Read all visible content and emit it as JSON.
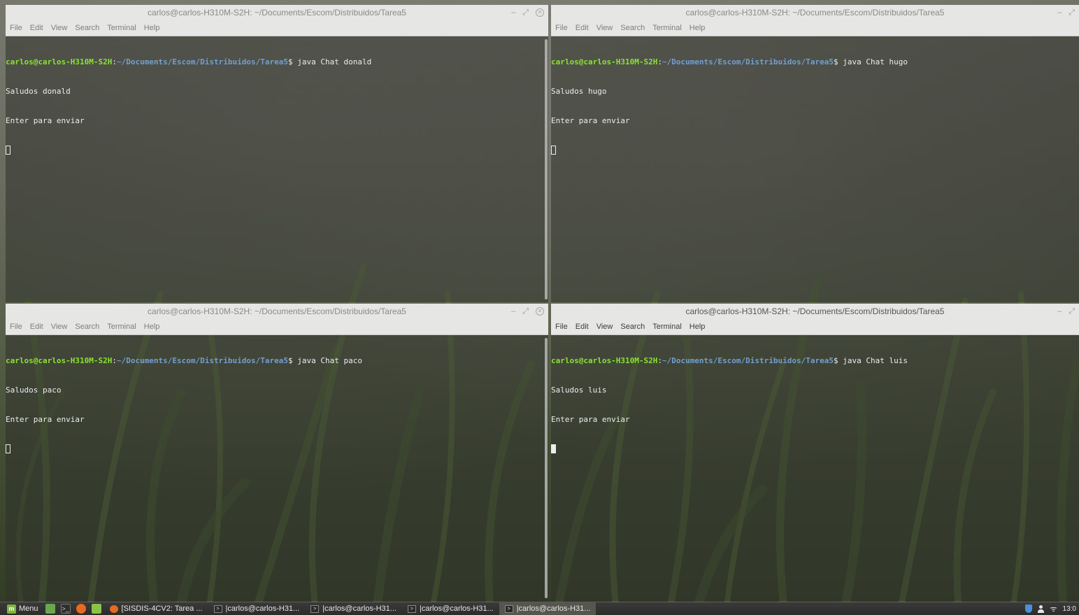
{
  "windows": [
    {
      "id": "tl",
      "title": "carlos@carlos-H310M-S2H: ~/Documents/Escom/Distribuidos/Tarea5",
      "menu": [
        "File",
        "Edit",
        "View",
        "Search",
        "Terminal",
        "Help"
      ],
      "prompt_user": "carlos@carlos-H310M-S2H",
      "prompt_colon": ":",
      "prompt_path": "~/Documents/Escom/Distribuidos/Tarea5",
      "command": "$ java Chat donald",
      "output": [
        "Saludos donald",
        "Enter para enviar"
      ],
      "focused": false,
      "has_close": true
    },
    {
      "id": "tr",
      "title": "carlos@carlos-H310M-S2H: ~/Documents/Escom/Distribuidos/Tarea5",
      "menu": [
        "File",
        "Edit",
        "View",
        "Search",
        "Terminal",
        "Help"
      ],
      "prompt_user": "carlos@carlos-H310M-S2H",
      "prompt_colon": ":",
      "prompt_path": "~/Documents/Escom/Distribuidos/Tarea5",
      "command": "$ java Chat hugo",
      "output": [
        "Saludos hugo",
        "Enter para enviar"
      ],
      "focused": false,
      "has_close": false
    },
    {
      "id": "bl",
      "title": "carlos@carlos-H310M-S2H: ~/Documents/Escom/Distribuidos/Tarea5",
      "menu": [
        "File",
        "Edit",
        "View",
        "Search",
        "Terminal",
        "Help"
      ],
      "prompt_user": "carlos@carlos-H310M-S2H",
      "prompt_colon": ":",
      "prompt_path": "~/Documents/Escom/Distribuidos/Tarea5",
      "command": "$ java Chat paco",
      "output": [
        "Saludos paco",
        "Enter para enviar"
      ],
      "focused": false,
      "has_close": true
    },
    {
      "id": "br",
      "title": "carlos@carlos-H310M-S2H: ~/Documents/Escom/Distribuidos/Tarea5",
      "menu": [
        "File",
        "Edit",
        "View",
        "Search",
        "Terminal",
        "Help"
      ],
      "prompt_user": "carlos@carlos-H310M-S2H",
      "prompt_colon": ":",
      "prompt_path": "~/Documents/Escom/Distribuidos/Tarea5",
      "command": "$ java Chat luis",
      "output": [
        "Saludos luis",
        "Enter para enviar"
      ],
      "focused": true,
      "has_close": false
    }
  ],
  "taskbar": {
    "menu_label": "Menu",
    "tasks": [
      {
        "label": "[SISDIS-4CV2: Tarea ...",
        "icon": "firefox-icon",
        "active": false
      },
      {
        "label": "|carlos@carlos-H31...",
        "icon": "terminal-icon",
        "active": false
      },
      {
        "label": "|carlos@carlos-H31...",
        "icon": "terminal-icon",
        "active": false
      },
      {
        "label": "|carlos@carlos-H31...",
        "icon": "terminal-icon",
        "active": false
      },
      {
        "label": "|carlos@carlos-H31...",
        "icon": "terminal-icon",
        "active": true
      }
    ],
    "clock": "13:0"
  },
  "colors": {
    "prompt_user": "#8ae234",
    "prompt_path": "#729fcf",
    "titlebar": "#e6e6e4",
    "taskbar": "#2c2c2a"
  }
}
